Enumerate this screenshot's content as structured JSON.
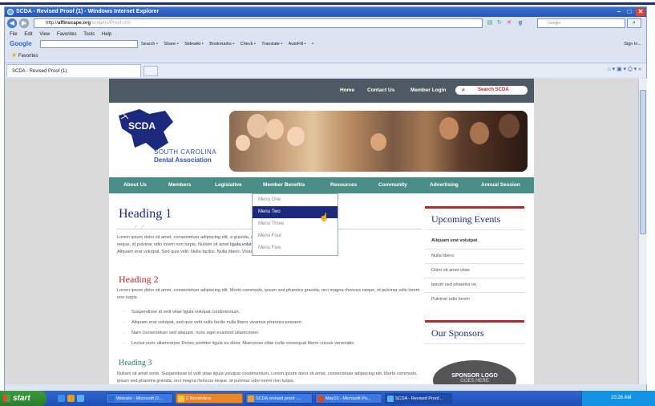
{
  "browser": {
    "title": "SCDA - Revised Proof (1) - Windows Internet Explorer",
    "address_host": "affinscape.org",
    "address_prefix": "http://",
    "address_path": "/scda/ns/Proof.cfm",
    "google_search_placeholder": "Google",
    "menu": [
      "File",
      "Edit",
      "View",
      "Favorites",
      "Tools",
      "Help"
    ],
    "google_toolbar": {
      "logo": "Google",
      "items": [
        "Search •",
        "Share •",
        "Sidewiki •",
        "Bookmarks •",
        "Check •",
        "Translate •",
        "AutoFill •",
        "•"
      ],
      "right_label": "Sign In..."
    },
    "favorites_label": "Favorites",
    "tab_label": "SCDA - Revised Proof (1)"
  },
  "site": {
    "top_links": [
      "Home",
      "Contact Us",
      "Member Login"
    ],
    "search_label": "Search SCDA",
    "logo_text": "SCDA",
    "org_line1": "SOUTH CAROLINA",
    "org_line2": "Dental Association",
    "nav": [
      "About Us",
      "Members",
      "Legislative",
      "Member Benefits",
      "Resources",
      "Community",
      "Advertising",
      "Annual Session"
    ],
    "dropdown": [
      "Menu One",
      "Menu Two",
      "Menu Three",
      "Menu Four",
      "Menu Five"
    ],
    "dropdown_active_index": 1,
    "content": {
      "heading1": "Heading 1",
      "para1_a": "Lorem ipsum dolor sit amet, consectetuer adipiscing elit.",
      "para1_b": "a gravida, orci magna rhoncus",
      "para1_c": "neque, id pulvinar odio lorem non turpis. Nullam sit amet",
      "para1_link": "ligula volutpat condimentum.",
      "para1_d": "Aliquam erat volutpat. Sed quis velit. Nulla facilisi. Nulla libero. Vivamus pharetra posuere sapien.",
      "heading2": "Heading 2",
      "para2": "Lorem ipsum dolor sit amet, consectetuer adipiscing elit. Morbi commodo, ipsum sed pharetra gravida, orci magna rhoncus neque, id pulvinar odio lorem non turpis.",
      "bullets": [
        "Suspendisse id velit vitae ligula volutpat condimentum.",
        "Aliquam erat volutpat, sed quis velit nulla facilis nulla libero vivamus pharetra posuere.",
        "Nam consectetuer sed aliquam, nunc eget euismod ullamcorper.",
        "Lectus nunc ullamcorper Donec porttitor ligula eu dolor. Maecenas vitae nulla consequat libero cursus venenatis."
      ],
      "heading3": "Heading 3",
      "para3": "Nullam sit amet enim. Suspendisse id velit vitae ligula volutpat condimentum. Lorem ipsum dolor sit amet, consectetuer adipiscing elit. Morbi commodo, ipsum sed pharetra gravida, orci magna rhoncus neque, id pulvinar odio lorem non turpis."
    },
    "sidebar": {
      "upcoming_title": "Upcoming Events",
      "events": [
        "Aliquam erat volutpat",
        "Nulla libero",
        "Dolor sit amet vitae",
        "Ipsum sed pharetra on",
        "Pulvinar odio lorem"
      ],
      "sponsors_title": "Our Sponsors",
      "sponsor_logo_line1": "SPONSOR LOGO",
      "sponsor_logo_line2": "GOES HERE"
    }
  },
  "taskbar": {
    "start_label": "start",
    "tasks": [
      "Website - Microsoft O...",
      "2 Reminders",
      "SCDA revised proof -...",
      "May10 - Microsoft Po...",
      "SCDA - Revised Proof..."
    ],
    "clock": "10:26 AM"
  },
  "colors": {
    "nav_teal": "#4a8d86",
    "heading_blue": "#1b2a7c",
    "heading_red": "#c0242b",
    "heading_green": "#2e7d6c"
  }
}
